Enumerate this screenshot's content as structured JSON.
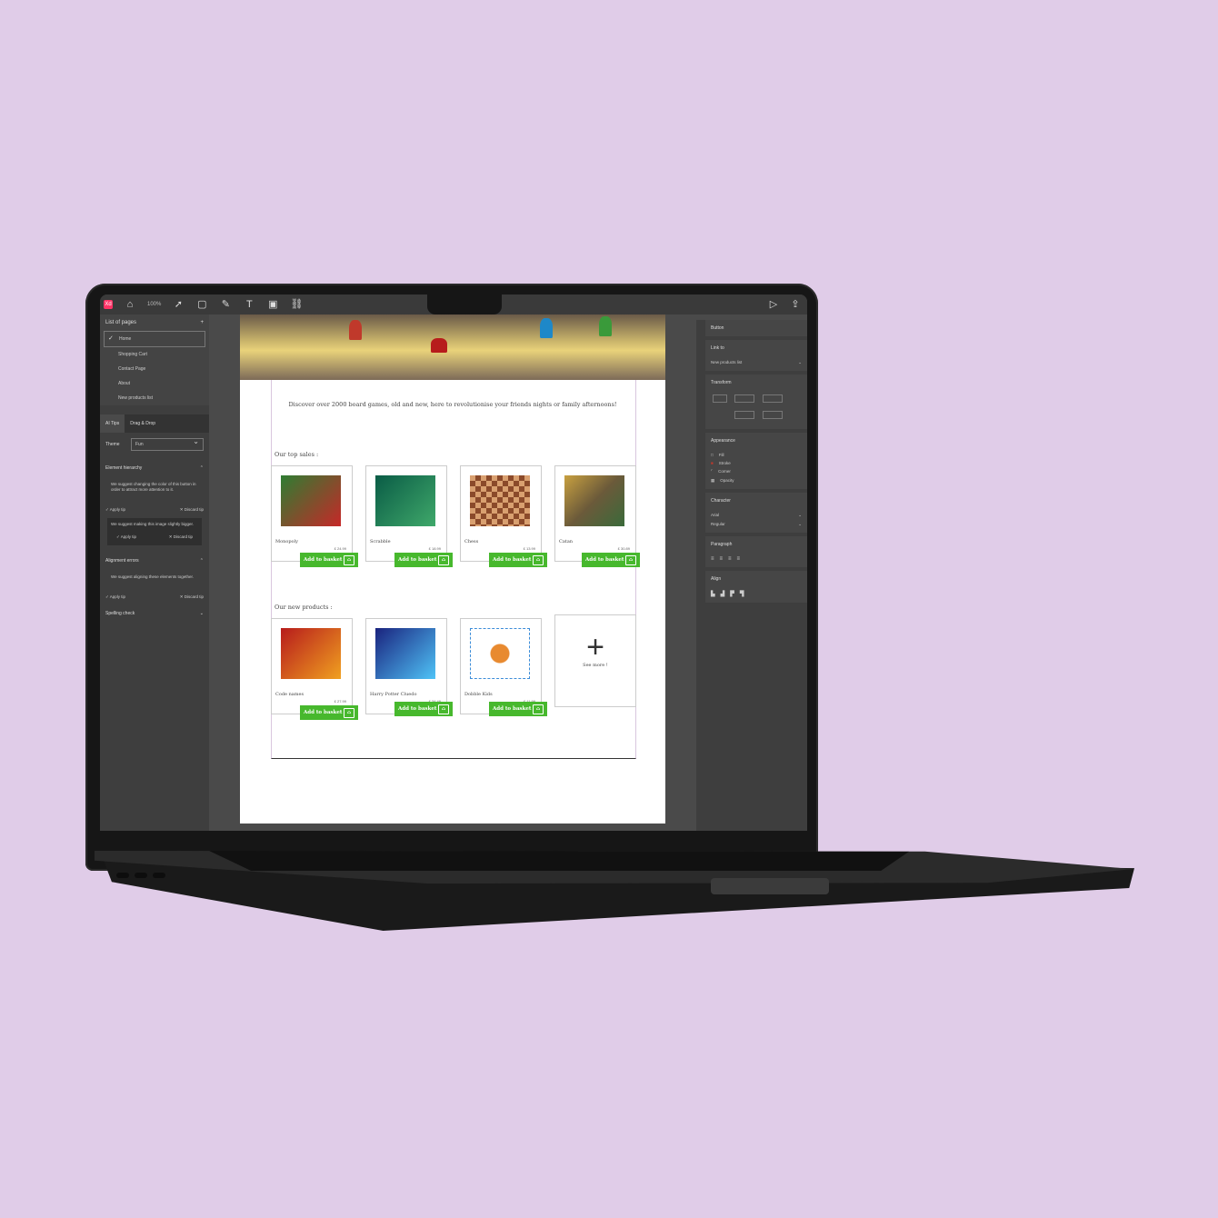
{
  "toolbar": {
    "zoom": "100%",
    "icons": [
      "home-icon",
      "select-icon",
      "rectangle-icon",
      "pen-icon",
      "text-icon",
      "image-icon",
      "link-icon",
      "play-icon",
      "export-icon"
    ]
  },
  "left_panel": {
    "pages_title": "List of pages",
    "pages": [
      "Home",
      "Shopping Cart",
      "Contact Page",
      "About",
      "New products list"
    ],
    "tabs": [
      "AI Tips",
      "Drag & Drop"
    ],
    "theme_label": "Theme",
    "theme_value": "Fun",
    "element_hierarchy": "Element hierarchy",
    "tip1": "We suggest changing the color of this button in order to attract more attention to it.",
    "tip2": "We suggest making this image slightly bigger.",
    "apply": "Apply tip",
    "discard": "Discard tip",
    "alignment_errors": "Alignment errors",
    "tip3": "We suggest aligning these elements together.",
    "spelling_check": "Spelling check"
  },
  "canvas": {
    "intro": "Discover over 2000 board games, old and new, here to revolutionise your friends nights or family afternoons!",
    "top_sales_label": "Our top sales :",
    "new_products_label": "Our new products :",
    "add_label": "Add to basket",
    "top_sales": [
      {
        "name": "Monopoly",
        "price": "£ 24.99"
      },
      {
        "name": "Scrabble",
        "price": "£ 18.99"
      },
      {
        "name": "Chess",
        "price": "£ 13.99"
      },
      {
        "name": "Catan",
        "price": "£ 30.89"
      }
    ],
    "new_products": [
      {
        "name": "Code names",
        "price": "£ 27.99"
      },
      {
        "name": "Harry Potter Cluedo",
        "price": "£ 34.49"
      },
      {
        "name": "Dobble Kids",
        "price": "£ 11.99"
      }
    ],
    "see_more": "See more !"
  },
  "right_panel": {
    "element_type": "Button",
    "link_to_label": "Link to",
    "link_to_value": "New products list",
    "transform": "Transform",
    "appearance": "Appearance",
    "fill": "Fill",
    "stroke": "Stroke",
    "corner": "Corner",
    "opacity": "Opacity",
    "character": "Character",
    "font": "Arial",
    "weight": "Regular",
    "paragraph": "Paragraph",
    "align": "Align"
  }
}
